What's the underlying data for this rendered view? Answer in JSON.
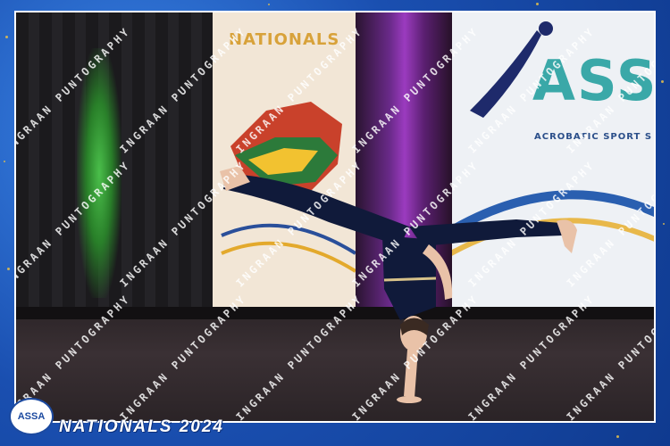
{
  "photo": {
    "description_alt": "",
    "banner_left_text": "NATIONALS",
    "banner_right_logo_text": "ASSA",
    "banner_right_subtitle": "ACROBATIC SPORT S"
  },
  "watermark": {
    "text": "INGRAAN PUNTOGRAPHY"
  },
  "footer": {
    "logo_text": "ASSA",
    "event_title": "NATIONALS 2024"
  },
  "colors": {
    "frame_blue": "#1d5fc4",
    "gold_accent": "#e8c14a",
    "leotard_navy": "#101a3a"
  }
}
